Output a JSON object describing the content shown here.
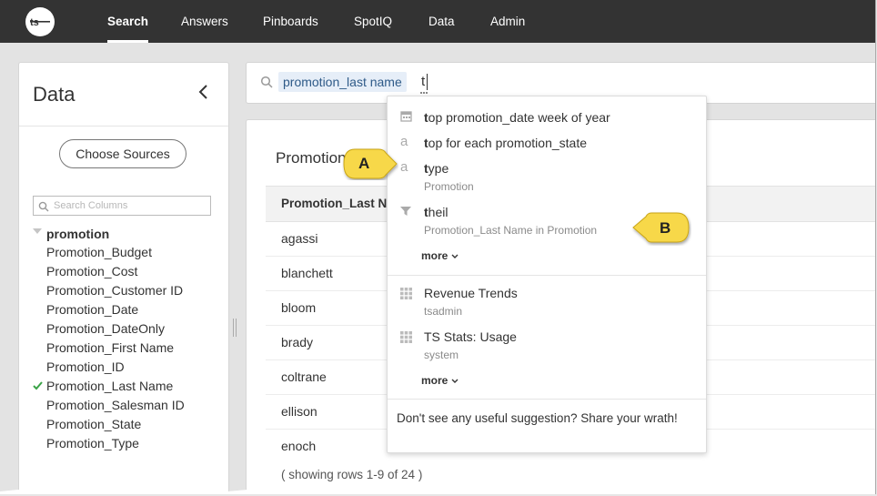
{
  "nav": {
    "items": [
      {
        "label": "Search",
        "active": true
      },
      {
        "label": "Answers",
        "active": false
      },
      {
        "label": "Pinboards",
        "active": false
      },
      {
        "label": "SpotIQ",
        "active": false
      },
      {
        "label": "Data",
        "active": false
      },
      {
        "label": "Admin",
        "active": false
      }
    ]
  },
  "data_panel": {
    "title": "Data",
    "choose_sources_label": "Choose Sources",
    "search_placeholder": "Search Columns",
    "source_name": "promotion",
    "columns": [
      {
        "label": "Promotion_Budget",
        "selected": false
      },
      {
        "label": "Promotion_Cost",
        "selected": false
      },
      {
        "label": "Promotion_Customer ID",
        "selected": false
      },
      {
        "label": "Promotion_Date",
        "selected": false
      },
      {
        "label": "Promotion_DateOnly",
        "selected": false
      },
      {
        "label": "Promotion_First Name",
        "selected": false
      },
      {
        "label": "Promotion_ID",
        "selected": false
      },
      {
        "label": "Promotion_Last Name",
        "selected": true
      },
      {
        "label": "Promotion_Salesman ID",
        "selected": false
      },
      {
        "label": "Promotion_State",
        "selected": false
      },
      {
        "label": "Promotion_Type",
        "selected": false
      }
    ]
  },
  "search_bar": {
    "token": "promotion_last name",
    "typed_text": "t"
  },
  "result": {
    "title": "Promotion_Last Name",
    "column_header": "Promotion_Last Name",
    "rows": [
      "agassi",
      "blanchett",
      "bloom",
      "brady",
      "coltrane",
      "ellison",
      "enoch"
    ],
    "row_count_text": "( showing rows 1-9 of 24 )"
  },
  "suggestions": {
    "items": [
      {
        "icon": "calendar-icon",
        "match": "t",
        "rest": "op promotion_date week of year",
        "sub": ""
      },
      {
        "icon": "attribute-icon",
        "match": "t",
        "rest": "op for each promotion_state",
        "sub": ""
      },
      {
        "icon": "attribute-icon",
        "match": "t",
        "rest": "ype",
        "sub": "Promotion"
      },
      {
        "icon": "filter-icon",
        "match": "t",
        "rest": "heil",
        "sub": "Promotion_Last Name in Promotion"
      }
    ],
    "more_label": "more",
    "saved": [
      {
        "icon": "grid-icon",
        "label": "Revenue Trends",
        "sub": "tsadmin"
      },
      {
        "icon": "grid-icon",
        "label": "TS Stats: Usage",
        "sub": "system"
      }
    ],
    "saved_more_label": "more",
    "footer": "Don't see any useful suggestion? Share your wrath!"
  },
  "callouts": [
    {
      "label": "A"
    },
    {
      "label": "B"
    }
  ],
  "colors": {
    "topbar": "#333333",
    "callout_fill": "#f7d84a",
    "token_bg": "#e6eef8",
    "check": "#3aa347"
  }
}
